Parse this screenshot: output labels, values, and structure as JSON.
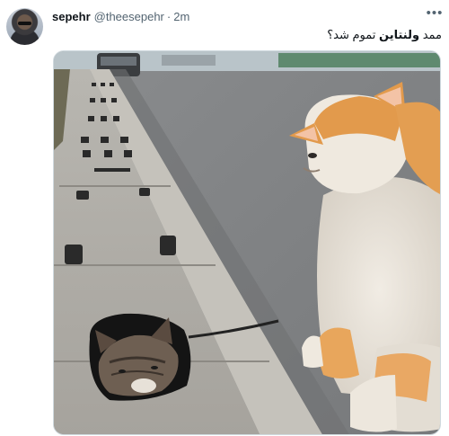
{
  "author": {
    "display_name": "sepehr",
    "handle": "@theesepehr",
    "separator": "·",
    "time": "2m"
  },
  "menu_icon": "more-horizontal-icon",
  "tweet": {
    "text_before": "ممد ",
    "text_bold": "ولنتاین",
    "text_after": " تموم شد؟"
  },
  "media": {
    "kind": "photo",
    "subject": "cat-in-pothole-photo"
  }
}
